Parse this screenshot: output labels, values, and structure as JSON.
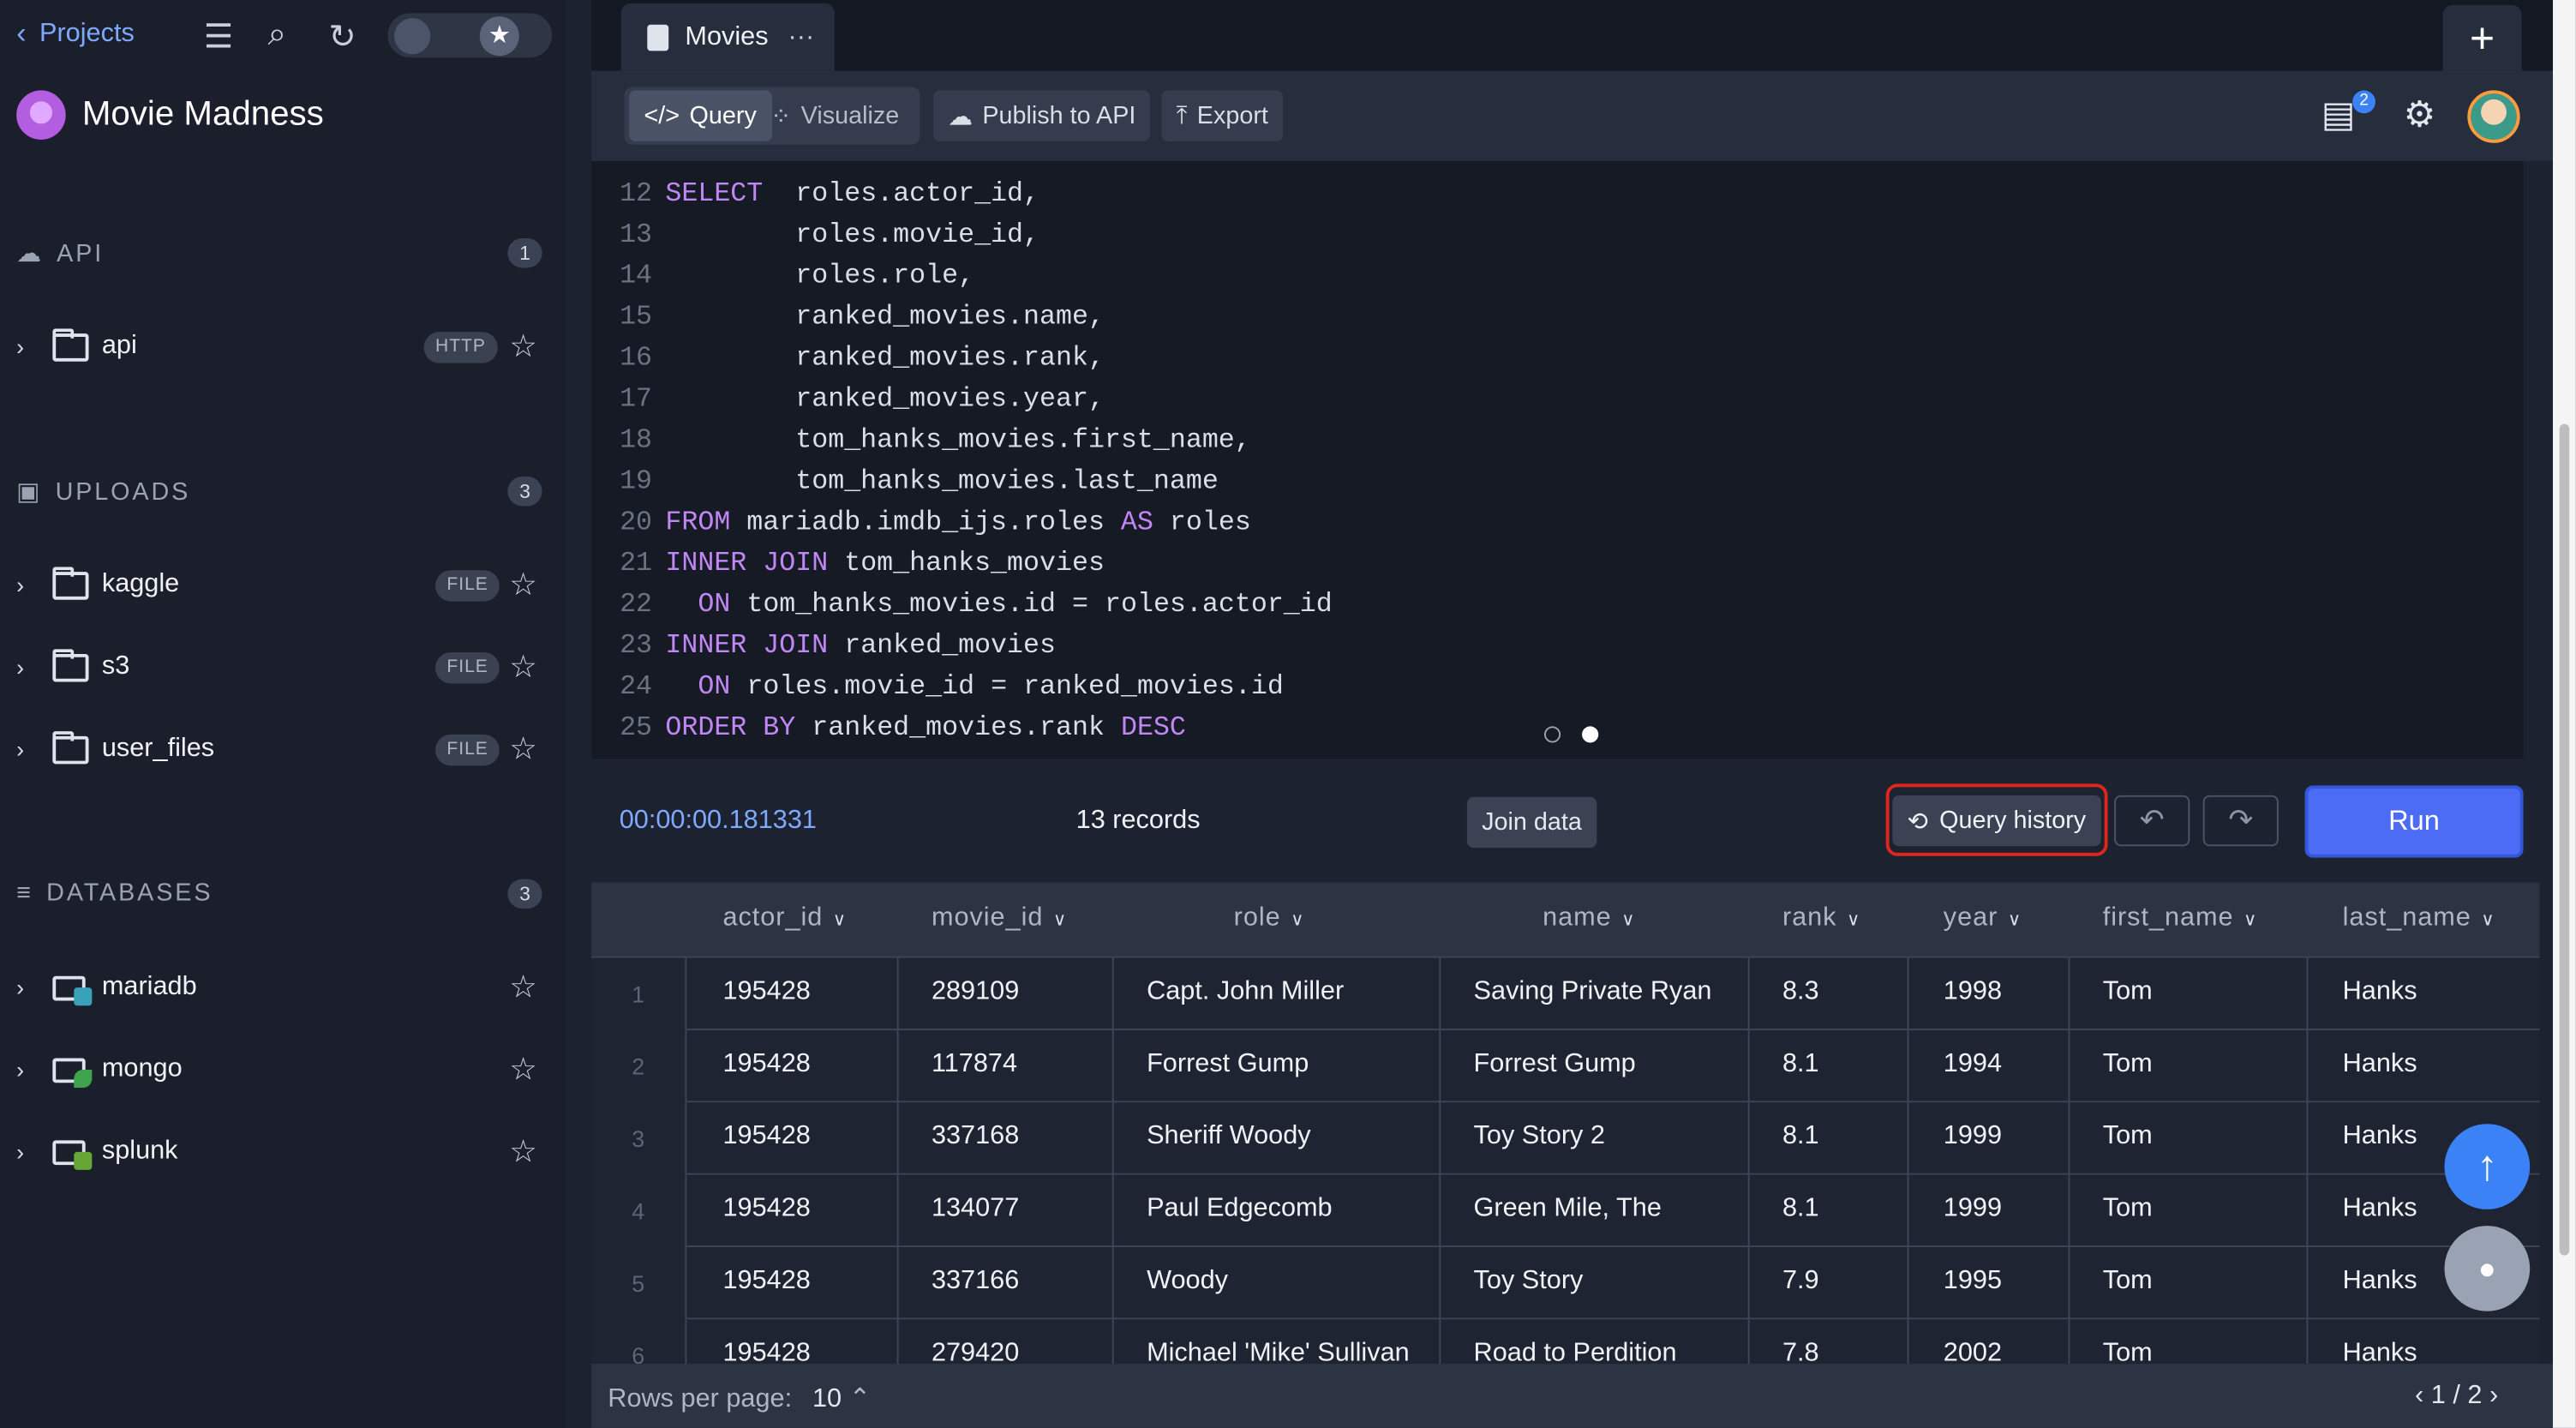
{
  "sidebar": {
    "back_label": "Projects",
    "project_name": "Movie Madness",
    "sections": [
      {
        "title": "API",
        "count": "1",
        "items": [
          {
            "label": "api",
            "tag": "HTTP"
          }
        ]
      },
      {
        "title": "UPLOADS",
        "count": "3",
        "items": [
          {
            "label": "kaggle",
            "tag": "FILE"
          },
          {
            "label": "s3",
            "tag": "FILE"
          },
          {
            "label": "user_files",
            "tag": "FILE"
          }
        ]
      },
      {
        "title": "DATABASES",
        "count": "3",
        "items": [
          {
            "label": "mariadb"
          },
          {
            "label": "mongo"
          },
          {
            "label": "splunk"
          }
        ]
      }
    ]
  },
  "tab": {
    "name": "Movies",
    "menu": "···"
  },
  "toolbar": {
    "query_label": "Query",
    "visualize_label": "Visualize",
    "publish_label": "Publish to API",
    "export_label": "Export",
    "notifications": "2"
  },
  "editor": {
    "lines": [
      {
        "n": "12",
        "code": "SELECT  roles.actor_id,"
      },
      {
        "n": "13",
        "code": "        roles.movie_id,"
      },
      {
        "n": "14",
        "code": "        roles.role,"
      },
      {
        "n": "15",
        "code": "        ranked_movies.name,"
      },
      {
        "n": "16",
        "code": "        ranked_movies.rank,"
      },
      {
        "n": "17",
        "code": "        ranked_movies.year,"
      },
      {
        "n": "18",
        "code": "        tom_hanks_movies.first_name,"
      },
      {
        "n": "19",
        "code": "        tom_hanks_movies.last_name"
      },
      {
        "n": "20",
        "code": "FROM mariadb.imdb_ijs.roles AS roles"
      },
      {
        "n": "21",
        "code": "INNER JOIN tom_hanks_movies"
      },
      {
        "n": "22",
        "code": "  ON tom_hanks_movies.id = roles.actor_id"
      },
      {
        "n": "23",
        "code": "INNER JOIN ranked_movies"
      },
      {
        "n": "24",
        "code": "  ON roles.movie_id = ranked_movies.id"
      },
      {
        "n": "25",
        "code": "ORDER BY ranked_movies.rank DESC"
      }
    ]
  },
  "status": {
    "elapsed": "00:00:00.181331",
    "records": "13 records",
    "join_label": "Join data",
    "history_label": "Query history",
    "run_label": "Run"
  },
  "table": {
    "columns": [
      "actor_id",
      "movie_id",
      "role",
      "name",
      "rank",
      "year",
      "first_name",
      "last_name"
    ],
    "rows": [
      [
        "1",
        "195428",
        "289109",
        "Capt. John Miller",
        "Saving Private Ryan",
        "8.3",
        "1998",
        "Tom",
        "Hanks"
      ],
      [
        "2",
        "195428",
        "117874",
        "Forrest Gump",
        "Forrest Gump",
        "8.1",
        "1994",
        "Tom",
        "Hanks"
      ],
      [
        "3",
        "195428",
        "337168",
        "Sheriff Woody",
        "Toy Story 2",
        "8.1",
        "1999",
        "Tom",
        "Hanks"
      ],
      [
        "4",
        "195428",
        "134077",
        "Paul Edgecomb",
        "Green Mile, The",
        "8.1",
        "1999",
        "Tom",
        "Hanks"
      ],
      [
        "5",
        "195428",
        "337166",
        "Woody",
        "Toy Story",
        "7.9",
        "1995",
        "Tom",
        "Hanks"
      ],
      [
        "6",
        "195428",
        "279420",
        "Michael 'Mike' Sullivan",
        "Road to Perdition",
        "7.8",
        "2002",
        "Tom",
        "Hanks"
      ]
    ]
  },
  "footer": {
    "rows_per_page_label": "Rows per page:",
    "rows_per_page": "10",
    "page": "1 / 2"
  },
  "colors": {
    "accent": "#4d6cf6",
    "keyword": "#c087f5",
    "highlight": "#e0261c"
  }
}
